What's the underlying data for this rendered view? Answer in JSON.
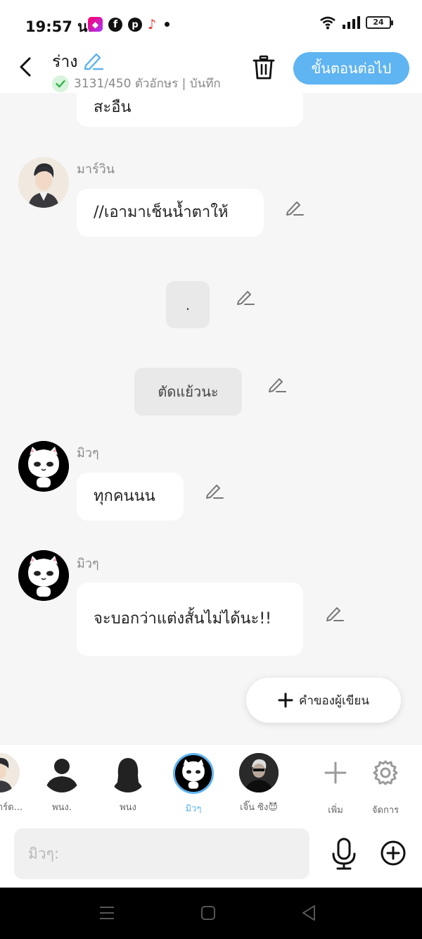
{
  "status_bar": {
    "time": "19:57 น.",
    "battery": "24"
  },
  "header": {
    "title": "ร่าง",
    "char_count": "3131/450 ตัวอักษร | บันทึก",
    "next_label": "ขั้นตอนต่อไป"
  },
  "messages": [
    {
      "sender": "",
      "text": "สะอืน"
    },
    {
      "sender": "มาร์วิน",
      "text": "//เอามาเช็นน้ำตาให้"
    },
    {
      "sender": "",
      "text": "."
    },
    {
      "sender": "",
      "text": "ตัดแย้วนะ"
    },
    {
      "sender": "มิวๆ",
      "text": "ทุกคนนน"
    },
    {
      "sender": "มิวๆ",
      "text": "จะบอกว่าแต่งสั้นไม่ได้นะ!!"
    }
  ],
  "author_button": "คำของผู้เขียน",
  "characters": [
    {
      "name": "มาร์ด..."
    },
    {
      "name": "พนง."
    },
    {
      "name": "พนง"
    },
    {
      "name": "มิวๆ"
    },
    {
      "name": "เจิ๊น ซิง😈"
    }
  ],
  "actions": {
    "add": "เพิ่ม",
    "manage": "จัดการ"
  },
  "input": {
    "placeholder": "มิวๆ:"
  },
  "colors": {
    "accent": "#5fb4f2",
    "background": "#f6f6f6"
  }
}
